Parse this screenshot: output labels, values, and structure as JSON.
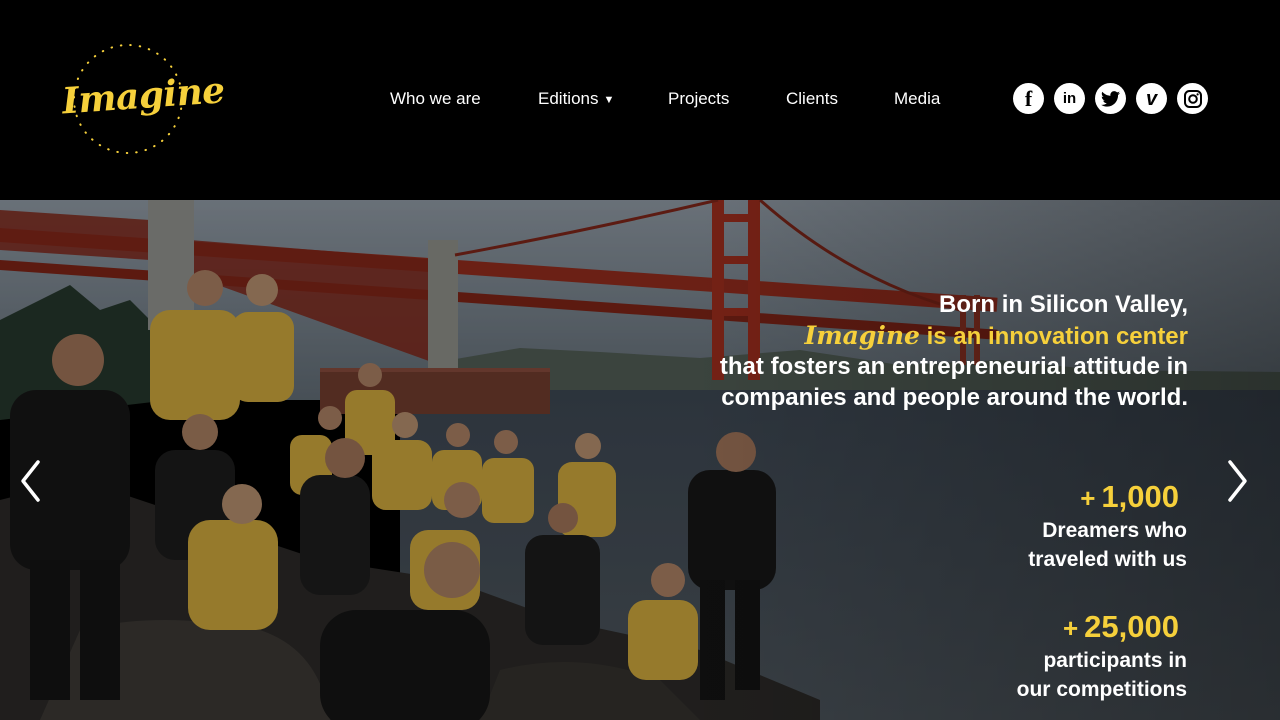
{
  "logo": {
    "text": "Imagine"
  },
  "nav": {
    "items": [
      {
        "label": "Who we are",
        "key": "who-we-are"
      },
      {
        "label": "Editions",
        "key": "editions",
        "dropdown": true
      },
      {
        "label": "Projects",
        "key": "projects"
      },
      {
        "label": "Clients",
        "key": "clients"
      },
      {
        "label": "Media",
        "key": "media"
      }
    ],
    "caret": "▼"
  },
  "socials": [
    {
      "icon": "facebook-icon",
      "glyph": "f"
    },
    {
      "icon": "linkedin-icon",
      "glyph": "in"
    },
    {
      "icon": "twitter-icon",
      "glyph": "t"
    },
    {
      "icon": "vimeo-icon",
      "glyph": "v"
    },
    {
      "icon": "instagram-icon",
      "glyph": "◎"
    }
  ],
  "hero": {
    "tagline": {
      "line1": "Born in Silicon Valley,",
      "brand": "Imagine",
      "line2_rest": " is an innovation center",
      "line3": "that fosters an entrepreneurial attitude in",
      "line4": "companies and people around the world."
    },
    "stats": [
      {
        "plus": "+",
        "value": "1,000",
        "line1": "Dreamers who",
        "line2": "traveled with us"
      },
      {
        "plus": "+",
        "value": "25,000",
        "line1": "participants in",
        "line2": "our competitions"
      }
    ]
  },
  "colors": {
    "accent": "#f6d03b",
    "bridge": "#8f2a1c",
    "background": "#000000"
  }
}
